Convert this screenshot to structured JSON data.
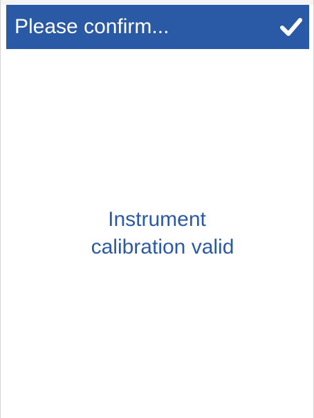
{
  "dialog": {
    "title": "Please confirm...",
    "confirm_icon": "checkmark-icon",
    "message_lines": [
      "Instrument",
      "calibration valid"
    ]
  },
  "colors": {
    "header_background": "#2a5aa5",
    "header_text": "#ffffff",
    "message_text": "#2a5aa5",
    "background": "#ffffff"
  }
}
